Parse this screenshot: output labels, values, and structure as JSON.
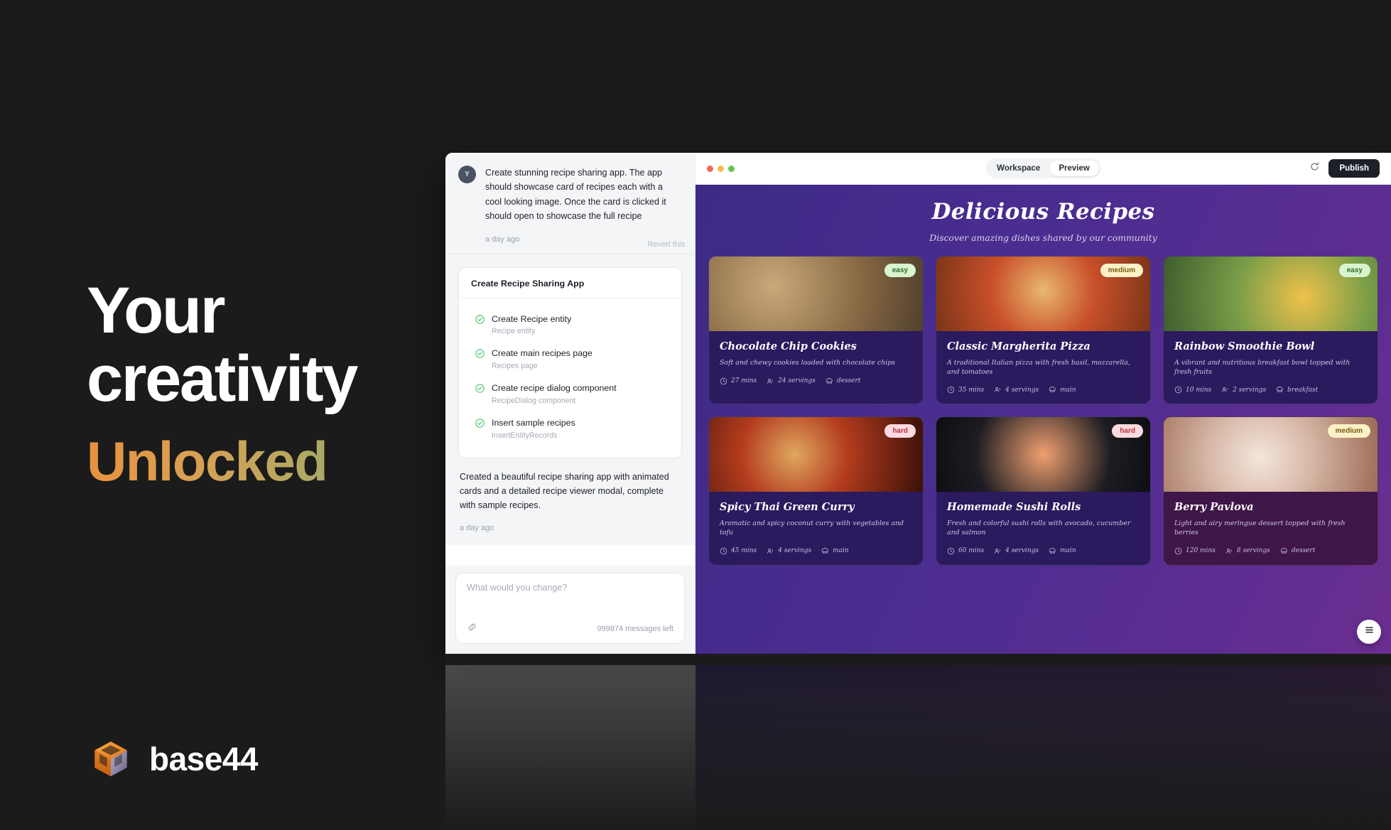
{
  "promo": {
    "line1": "Your",
    "line2": "creativity",
    "line3": "Unlocked",
    "gradient_start": "#E8913F",
    "gradient_end": "#8BAE79"
  },
  "brand": {
    "name": "base44",
    "logo_icon": "cube-logo-icon",
    "logo_color": "#F08A24"
  },
  "chat": {
    "user_message": {
      "avatar_initial": "Y",
      "text": "Create stunning recipe sharing app. The app should showcase card of recipes each with a cool looking image. Once the card is clicked it should open to showcase the full recipe",
      "timestamp": "a day ago",
      "revert_label": "Revert this"
    },
    "task_card": {
      "title": "Create Recipe Sharing App",
      "items": [
        {
          "label": "Create Recipe entity",
          "sub": "Recipe entity",
          "status": "done"
        },
        {
          "label": "Create main recipes page",
          "sub": "Recipes page",
          "status": "done"
        },
        {
          "label": "Create recipe dialog component",
          "sub": "RecipeDialog component",
          "status": "done"
        },
        {
          "label": "Insert sample recipes",
          "sub": "InsertEntityRecords",
          "status": "done"
        }
      ]
    },
    "assistant_message": {
      "text": "Created a beautiful recipe sharing app with animated cards and a detailed recipe viewer modal, complete with sample recipes.",
      "timestamp": "a day ago"
    },
    "composer": {
      "placeholder": "What would you change?",
      "attach_icon": "link-icon",
      "messages_left": "999874 messages left"
    }
  },
  "toolbar": {
    "traffic_lights": [
      "close",
      "minimize",
      "maximize"
    ],
    "tabs": [
      {
        "label": "Workspace",
        "active": false
      },
      {
        "label": "Preview",
        "active": true
      }
    ],
    "refresh_icon": "refresh-icon",
    "publish_label": "Publish"
  },
  "app": {
    "title": "Delicious Recipes",
    "subtitle": "Discover amazing dishes shared by our community",
    "fab_icon": "menu-icon",
    "recipes": [
      {
        "name": "Chocolate Chip Cookies",
        "description": "Soft and chewy cookies loaded with chocolate chips",
        "difficulty": "easy",
        "time": "27 mins",
        "servings": "24 servings",
        "category": "dessert"
      },
      {
        "name": "Classic Margherita Pizza",
        "description": "A traditional Italian pizza with fresh basil, mozzarella, and tomatoes",
        "difficulty": "medium",
        "time": "35 mins",
        "servings": "4 servings",
        "category": "main"
      },
      {
        "name": "Rainbow Smoothie Bowl",
        "description": "A vibrant and nutritious breakfast bowl topped with fresh fruits",
        "difficulty": "easy",
        "time": "10 mins",
        "servings": "2 servings",
        "category": "breakfast"
      },
      {
        "name": "Spicy Thai Green Curry",
        "description": "Aromatic and spicy coconut curry with vegetables and tofu",
        "difficulty": "hard",
        "time": "45 mins",
        "servings": "4 servings",
        "category": "main"
      },
      {
        "name": "Homemade Sushi Rolls",
        "description": "Fresh and colorful sushi rolls with avocado, cucumber and salmon",
        "difficulty": "hard",
        "time": "60 mins",
        "servings": "4 servings",
        "category": "main"
      },
      {
        "name": "Berry Pavlova",
        "description": "Light and airy meringue dessert topped with fresh berries",
        "difficulty": "medium",
        "time": "120 mins",
        "servings": "8 servings",
        "category": "dessert"
      }
    ]
  }
}
